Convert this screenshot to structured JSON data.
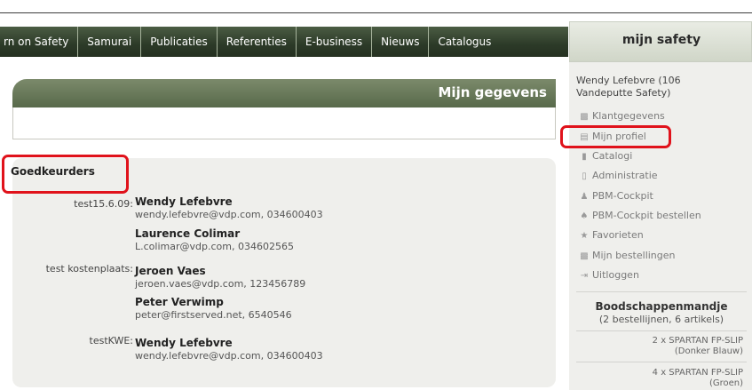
{
  "nav": {
    "items": [
      "rn on Safety",
      "Samurai",
      "Publicaties",
      "Referenties",
      "E-business",
      "Nieuws",
      "Catalogus"
    ]
  },
  "page": {
    "title": "Mijn gegevens"
  },
  "approvers": {
    "title": "Goedkeurders",
    "groups": [
      {
        "label": "test15.6.09:",
        "people": [
          {
            "name": "Wendy Lefebvre",
            "contact": "wendy.lefebvre@vdp.com, 034600403"
          },
          {
            "name": "Laurence Colimar",
            "contact": "L.colimar@vdp.com, 034602565"
          }
        ]
      },
      {
        "label": "test kostenplaats:",
        "people": [
          {
            "name": "Jeroen Vaes",
            "contact": "jeroen.vaes@vdp.com, 123456789"
          },
          {
            "name": "Peter Verwimp",
            "contact": "peter@firstserved.net, 6540546"
          }
        ]
      },
      {
        "label": "testKWE:",
        "people": [
          {
            "name": "Wendy Lefebvre",
            "contact": "wendy.lefebvre@vdp.com, 034600403"
          }
        ]
      }
    ]
  },
  "sidebar": {
    "title": "mijn safety",
    "user_line1": "Wendy Lefebvre (106",
    "user_line2": "Vandeputte Safety)",
    "menu": [
      {
        "label": "Klantgegevens",
        "icon": "chart-icon"
      },
      {
        "label": "Mijn profiel",
        "icon": "profile-card-icon"
      },
      {
        "label": "Catalogi",
        "icon": "book-icon"
      },
      {
        "label": "Administratie",
        "icon": "document-icon"
      },
      {
        "label": "PBM-Cockpit",
        "icon": "people-icon"
      },
      {
        "label": "PBM-Cockpit bestellen",
        "icon": "order-people-icon"
      },
      {
        "label": "Favorieten",
        "icon": "star-icon"
      },
      {
        "label": "Mijn bestellingen",
        "icon": "orders-chart-icon"
      },
      {
        "label": "Uitloggen",
        "icon": "logout-icon"
      }
    ],
    "basket": {
      "title": "Boodschappenmandje",
      "summary": "(2 bestellijnen, 6 artikels)",
      "items": [
        {
          "line1": "2 x SPARTAN FP-SLIP",
          "line2": "(Donker Blauw)"
        },
        {
          "line1": "4 x SPARTAN FP-SLIP",
          "line2": "(Groen)"
        }
      ]
    }
  },
  "colors": {
    "nav_bg": "#2c3a28",
    "header_bg": "#6b7a5c",
    "highlight": "#e0121b",
    "panel_bg": "#efefec"
  }
}
